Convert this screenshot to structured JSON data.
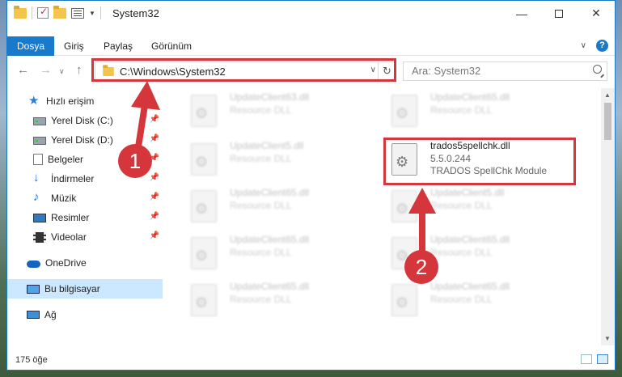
{
  "window": {
    "title": "System32"
  },
  "ribbon": {
    "tabs": [
      {
        "label": "Dosya",
        "active": true
      },
      {
        "label": "Giriş",
        "active": false
      },
      {
        "label": "Paylaş",
        "active": false
      },
      {
        "label": "Görünüm",
        "active": false
      }
    ]
  },
  "address": {
    "path": "C:\\Windows\\System32"
  },
  "search": {
    "placeholder": "Ara: System32"
  },
  "nav": {
    "items": [
      {
        "label": "Hızlı erişim"
      },
      {
        "label": "Yerel Disk (C:)"
      },
      {
        "label": "Yerel Disk (D:)"
      },
      {
        "label": "Belgeler"
      },
      {
        "label": "İndirmeler"
      },
      {
        "label": "Müzik"
      },
      {
        "label": "Resimler"
      },
      {
        "label": "Videolar"
      },
      {
        "label": "OneDrive"
      },
      {
        "label": "Bu bilgisayar"
      },
      {
        "label": "Ağ"
      }
    ]
  },
  "files": [
    {
      "name": "UpdateClient63.dll",
      "desc": "Resource DLL"
    },
    {
      "name": "UpdateClient65.dll",
      "desc": "Resource DLL"
    },
    {
      "name": "UpdateClient5.dll",
      "desc": "Resource DLL"
    },
    {
      "name": "trados5spellchk.dll",
      "version": "5.5.0.244",
      "desc": "TRADOS SpellChk Module"
    },
    {
      "name": "UpdateClient65.dll",
      "desc": "Resource DLL"
    },
    {
      "name": "UpdateClient5.dll",
      "desc": "Resource DLL"
    },
    {
      "name": "UpdateClient65.dll",
      "desc": "Resource DLL"
    },
    {
      "name": "UpdateClient65.dll",
      "desc": "Resource DLL"
    },
    {
      "name": "UpdateClient65.dll",
      "desc": "Resource DLL"
    },
    {
      "name": "UpdateClient65.dll",
      "desc": "Resource DLL"
    }
  ],
  "status": {
    "count": "175 öğe"
  },
  "annotations": {
    "step1": "1",
    "step2": "2"
  },
  "colors": {
    "accent": "#1979ca",
    "annotation": "#d5363b",
    "selected": "#cce8ff"
  }
}
